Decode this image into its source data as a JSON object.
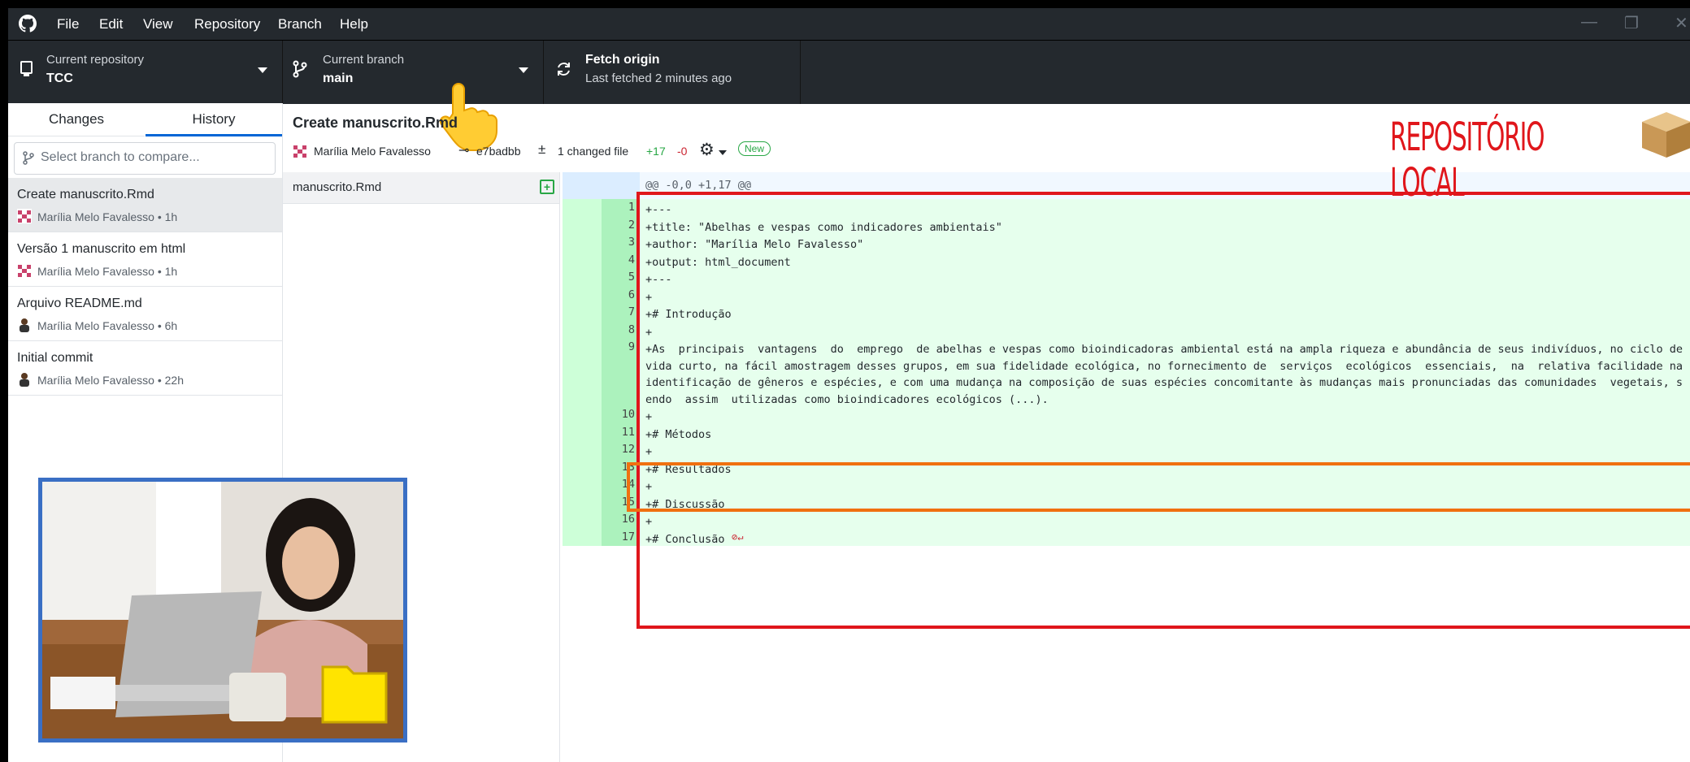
{
  "menubar": {
    "items": [
      "File",
      "Edit",
      "View",
      "Repository",
      "Branch",
      "Help"
    ],
    "window_controls": [
      "—",
      "❐",
      "✕"
    ]
  },
  "toolbar": {
    "repo": {
      "label": "Current repository",
      "value": "TCC"
    },
    "branch": {
      "label": "Current branch",
      "value": "main"
    },
    "fetch": {
      "label": "Fetch origin",
      "sub": "Last fetched 2 minutes ago"
    }
  },
  "sidebar": {
    "tabs": [
      "Changes",
      "History"
    ],
    "active_tab": "History",
    "compare_placeholder": "Select branch to compare...",
    "commits": [
      {
        "title": "Create manuscrito.Rmd",
        "meta": "Marília Melo Favalesso • 1h"
      },
      {
        "title": "Versão 1 manuscrito em html",
        "meta": "Marília Melo Favalesso • 1h"
      },
      {
        "title": "Arquivo README.md",
        "meta": "Marília Melo Favalesso • 6h"
      },
      {
        "title": "Initial commit",
        "meta": "Marília Melo Favalesso • 22h"
      }
    ]
  },
  "commit_detail": {
    "title": "Create manuscrito.Rmd",
    "author": "Marília Melo Favalesso",
    "sha": "e7badbb",
    "changed": "1 changed file",
    "additions": "+17",
    "deletions": "-0",
    "badge": "New"
  },
  "files": [
    {
      "name": "manuscrito.Rmd",
      "status": "+"
    }
  ],
  "diff": {
    "hunk": "@@ -0,0 +1,17 @@",
    "lines": [
      {
        "n": "1",
        "t": "+---"
      },
      {
        "n": "2",
        "t": "+title: \"Abelhas e vespas como indicadores ambientais\""
      },
      {
        "n": "3",
        "t": "+author: \"Marília Melo Favalesso\""
      },
      {
        "n": "4",
        "t": "+output: html_document"
      },
      {
        "n": "5",
        "t": "+---"
      },
      {
        "n": "6",
        "t": "+"
      },
      {
        "n": "7",
        "t": "+# Introdução"
      },
      {
        "n": "8",
        "t": "+"
      },
      {
        "n": "9",
        "t": "+As  principais  vantagens  do  emprego  de abelhas e vespas como bioindicadoras ambiental está na ampla riqueza e abundância de seus indivíduos, no ciclo de\nvida curto, na fácil amostragem desses grupos, em sua fidelidade ecológica, no fornecimento de  serviços  ecológicos  essenciais,  na  relativa facilidade na\nidentificação de gêneros e espécies, e com uma mudança na composição de suas espécies concomitante às mudanças mais pronunciadas das comunidades  vegetais, s\nendo  assim  utilizadas como bioindicadores ecológicos (...)."
      },
      {
        "n": "10",
        "t": "+"
      },
      {
        "n": "11",
        "t": "+# Métodos"
      },
      {
        "n": "12",
        "t": "+"
      },
      {
        "n": "13",
        "t": "+# Resultados"
      },
      {
        "n": "14",
        "t": "+"
      },
      {
        "n": "15",
        "t": "+# Discussão"
      },
      {
        "n": "16",
        "t": "+"
      },
      {
        "n": "17",
        "t": "+# Conclusão"
      }
    ]
  },
  "overlay": {
    "stamp": "REPOSITÓRIO LOCAL"
  },
  "colors": {
    "titlebar": "#24292e",
    "accent": "#0366d6",
    "add_bg": "#e6ffed",
    "add_gutter": "#cdffd8",
    "red_box": "#e0161b",
    "orange_box": "#f07010",
    "photo_border": "#3a6fc4"
  }
}
